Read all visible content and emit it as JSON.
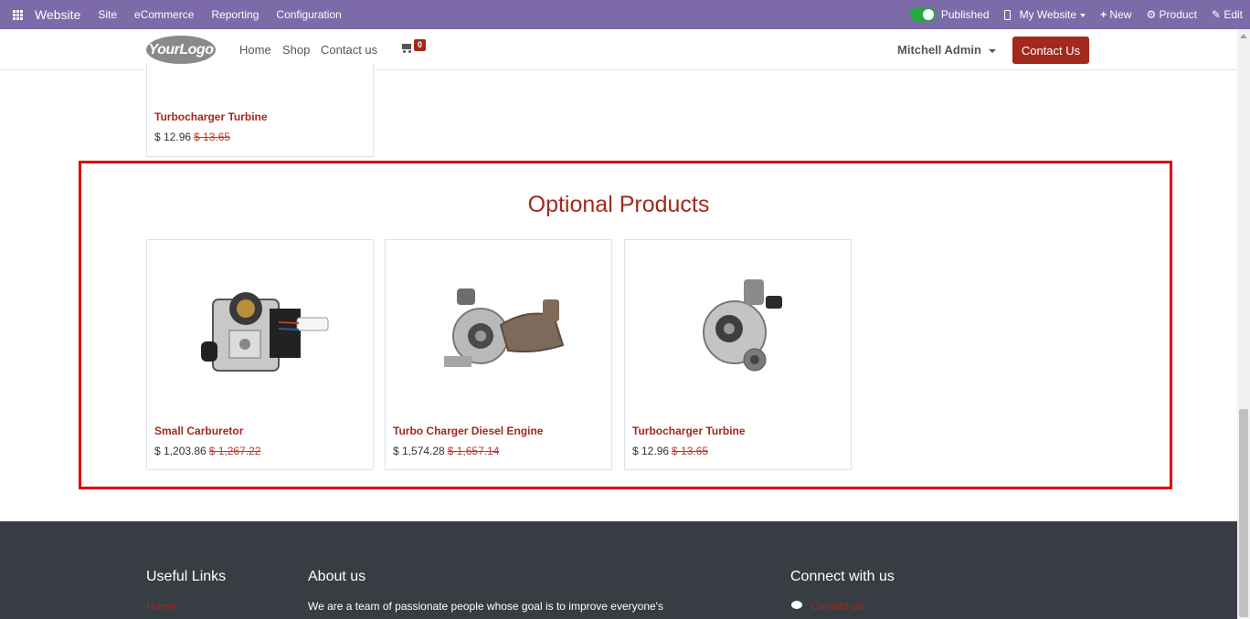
{
  "admin_bar": {
    "brand": "Website",
    "menus": [
      "Site",
      "eCommerce",
      "Reporting",
      "Configuration"
    ],
    "published_label": "Published",
    "website_selector": "My Website",
    "new_label": "New",
    "product_label": "Product",
    "edit_label": "Edit"
  },
  "header": {
    "logo_text": "YourLogo",
    "nav": [
      "Home",
      "Shop",
      "Contact us"
    ],
    "cart_count": "0",
    "user_name": "Mitchell Admin",
    "contact_button": "Contact Us"
  },
  "previous_product": {
    "name": "Turbocharger Turbine",
    "price": "$ 12.96",
    "old_price": "$ 13.65"
  },
  "optional_products": {
    "title": "Optional Products",
    "items": [
      {
        "name": "Small Carburetor",
        "price": "$ 1,203.86",
        "old_price": "$ 1,267.22",
        "icon": "carburetor-image"
      },
      {
        "name": "Turbo Charger Diesel Engine",
        "price": "$ 1,574.28",
        "old_price": "$ 1,657.14",
        "icon": "turbocharger-diesel-image"
      },
      {
        "name": "Turbocharger Turbine",
        "price": "$ 12.96",
        "old_price": "$ 13.65",
        "icon": "turbocharger-turbine-image"
      }
    ]
  },
  "footer": {
    "useful_links_title": "Useful Links",
    "useful_links_first": "Home",
    "about_title": "About us",
    "about_text": "We are a team of passionate people whose goal is to improve everyone's",
    "connect_title": "Connect with us",
    "connect_first": "Contact us"
  },
  "colors": {
    "admin_bar": "#7c6ba8",
    "brand_accent": "#a3291c",
    "highlight_border": "#e00000",
    "footer_bg": "#373d42"
  }
}
